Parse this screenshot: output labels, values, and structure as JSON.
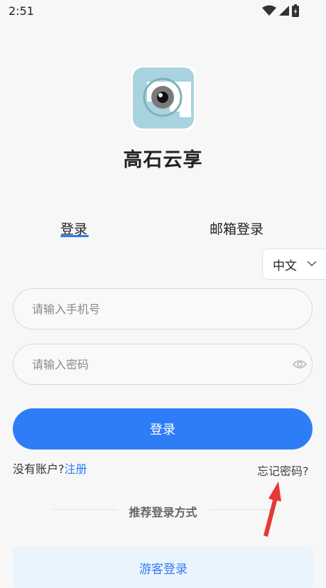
{
  "status_bar": {
    "time": "2:51"
  },
  "app": {
    "title": "高石云享"
  },
  "tabs": {
    "login": "登录",
    "email_login": "邮箱登录"
  },
  "language": {
    "selected": "中文"
  },
  "form": {
    "phone_placeholder": "请输入手机号",
    "password_placeholder": "请输入密码",
    "login_button": "登录"
  },
  "links": {
    "no_account": "没有账户?",
    "register": "注册",
    "forgot_password": "忘记密码?"
  },
  "recommended": {
    "label": "推荐登录方式",
    "guest_login": "游客登录"
  },
  "colors": {
    "accent": "#2f7df6",
    "annotation_arrow": "#e53935"
  }
}
